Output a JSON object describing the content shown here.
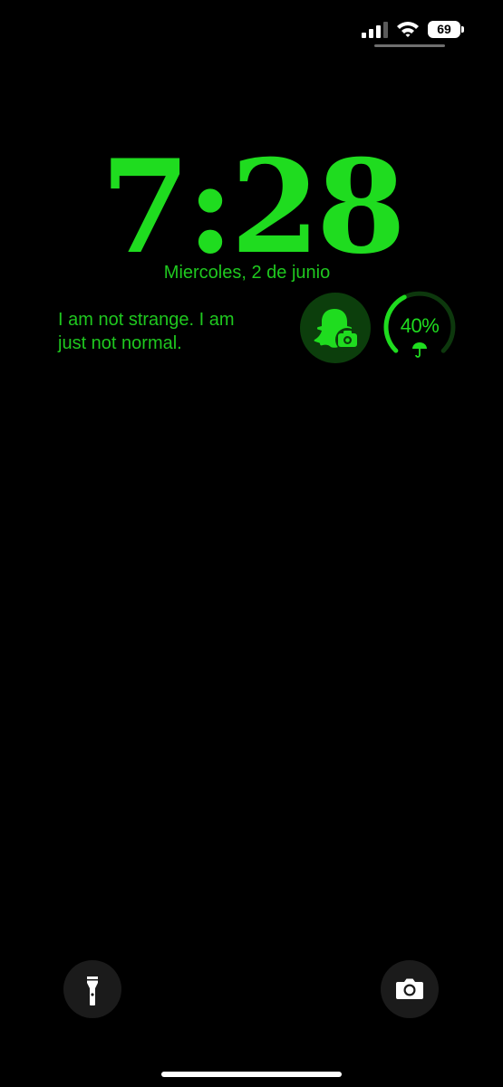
{
  "status_bar": {
    "battery_level": "69",
    "cellular_bars": 3,
    "wifi_icon": "wifi-icon"
  },
  "lock_screen": {
    "time": "7:28",
    "date": "Miercoles, 2 de junio",
    "quote": "I am not strange. I am just not normal.",
    "widgets": {
      "snapchat": {
        "icon": "snapchat-ghost-camera-icon"
      },
      "rain": {
        "percent": 40,
        "label": "40%",
        "icon": "umbrella-icon"
      }
    }
  },
  "quick_actions": {
    "flashlight": {
      "icon": "flashlight-icon"
    },
    "camera": {
      "icon": "camera-icon"
    }
  },
  "colors": {
    "accent": "#1fdc1f",
    "background": "#000000",
    "widget_bg": "#0c3e0c"
  }
}
